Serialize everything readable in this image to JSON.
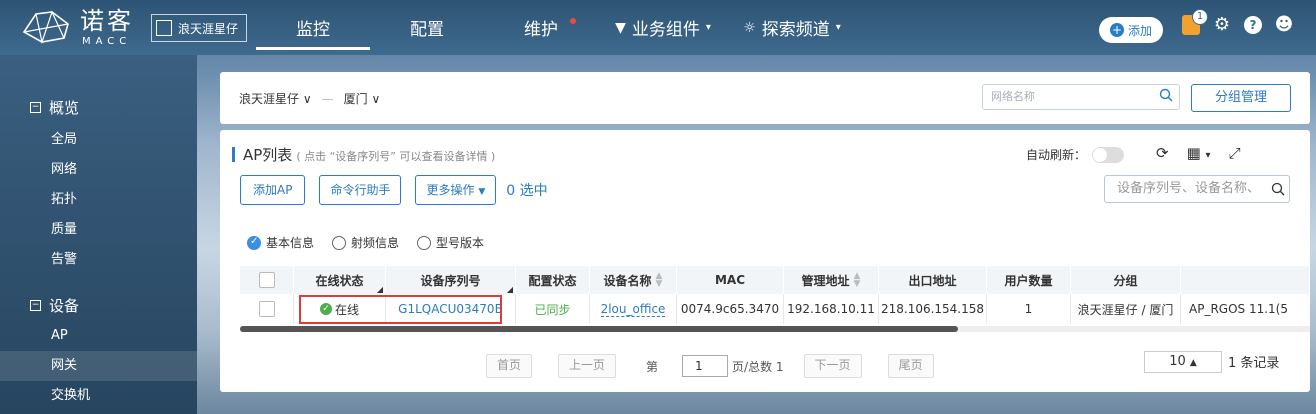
{
  "header": {
    "brand": "诺客",
    "brand_sub": "MACC",
    "tenant": "浪天涯星仔",
    "nav": [
      {
        "label": "监控"
      },
      {
        "label": "配置"
      },
      {
        "label": "维护"
      },
      {
        "label": "业务组件"
      },
      {
        "label": "探索频道"
      }
    ],
    "add_label": "添加",
    "notify_count": "1",
    "help_label": "?",
    "colors": {
      "accent": "#2b7bc5",
      "notify": "#f0a22e",
      "alert_dot": "#e74c3c"
    }
  },
  "sidebar": {
    "groups": [
      {
        "label": "概览",
        "items": [
          "全局",
          "网络",
          "拓扑",
          "质量",
          "告警"
        ]
      },
      {
        "label": "设备",
        "items": [
          "AP",
          "网关",
          "交换机"
        ]
      }
    ]
  },
  "filter": {
    "crumb_tenant": "浪天涯星仔",
    "crumb_location": "厦门",
    "net_search_placeholder": "网络名称",
    "group_manage_label": "分组管理"
  },
  "panel": {
    "title": "AP列表",
    "hint": "( 点击 “设备序列号” 可以查看设备详情 )",
    "auto_refresh_label": "自动刷新：",
    "buttons": {
      "add_ap": "添加AP",
      "cmd_helper": "命令行助手",
      "more_ops": "更多操作"
    },
    "selected_text": "0 选中",
    "search_placeholder": "设备序列号、设备名称、",
    "radios": [
      "基本信息",
      "射频信息",
      "型号版本"
    ],
    "table": {
      "headers": [
        "在线状态",
        "设备序列号",
        "配置状态",
        "设备名称",
        "MAC",
        "管理地址",
        "出口地址",
        "用户数量",
        "分组"
      ],
      "rows": [
        {
          "status": "在线",
          "serial": "G1LQACU03470B",
          "config": "已同步",
          "name": "2lou_office",
          "mac": "0074.9c65.3470",
          "mgmt": "192.168.10.11",
          "egress": "218.106.154.158",
          "users": "1",
          "group": "浪天涯星仔 / 厦门",
          "extra": "AP_RGOS 11.1(5"
        }
      ]
    },
    "pager": {
      "first": "首页",
      "prev": "上一页",
      "page_label": "第",
      "page_value": "1",
      "total_label": "页/总数 1",
      "next": "下一页",
      "last": "尾页",
      "page_size": "10",
      "total_records": "1 条记录"
    }
  }
}
